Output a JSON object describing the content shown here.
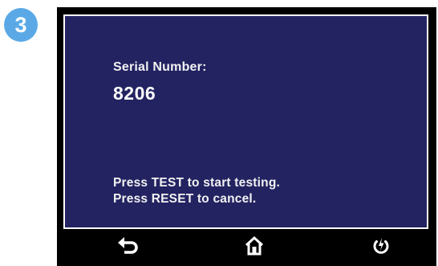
{
  "step": {
    "number": "3"
  },
  "screen": {
    "serial_label": "Serial Number:",
    "serial_value": "8206",
    "instructions": [
      "Press TEST to start testing.",
      "Press RESET to cancel."
    ],
    "background_color": "#232362"
  },
  "nav": {
    "buttons": [
      {
        "icon": "back-arrow-icon"
      },
      {
        "icon": "home-icon"
      },
      {
        "icon": "power-icon"
      }
    ]
  }
}
